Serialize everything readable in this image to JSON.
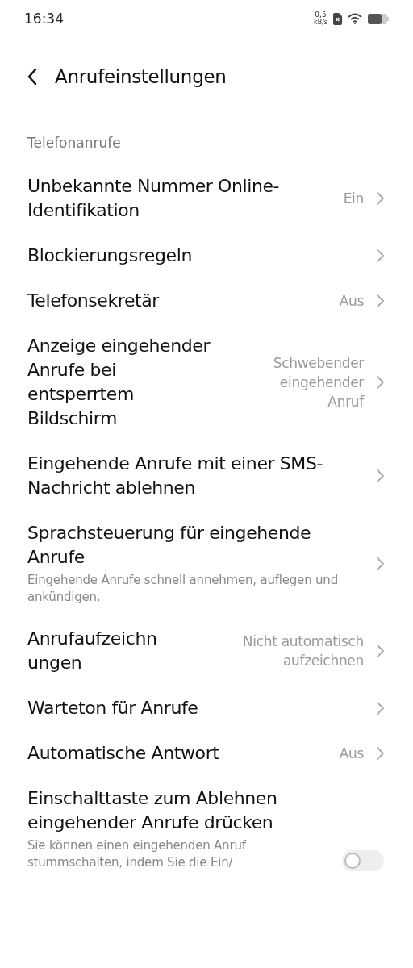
{
  "status_bar": {
    "time": "16:34",
    "net_speed": "0,5",
    "net_unit": "kB/s"
  },
  "header": {
    "title": "Anrufeinstellungen"
  },
  "section": {
    "title": "Telefonanrufe"
  },
  "items": [
    {
      "kind": "nav",
      "title": "Unbekannte Nummer Online-Identifikation",
      "value": "Ein"
    },
    {
      "kind": "nav",
      "title": "Blockierungsregeln"
    },
    {
      "kind": "nav",
      "title": "Telefonsekretär",
      "value": "Aus"
    },
    {
      "kind": "nav",
      "title": "Anzeige eingehender Anrufe bei entsperrtem Bildschirm",
      "value": "Schwebender eingehender Anruf"
    },
    {
      "kind": "nav",
      "title": "Eingehende Anrufe mit einer SMS-Nachricht ablehnen"
    },
    {
      "kind": "nav",
      "title": "Sprachsteuerung für eingehende Anrufe",
      "subtitle": "Eingehende Anrufe schnell annehmen, auflegen und ankündigen."
    },
    {
      "kind": "nav",
      "title": "Anrufaufzeichn ungen",
      "value": "Nicht automatisch aufzeichnen"
    },
    {
      "kind": "nav",
      "title": "Warteton für Anrufe"
    },
    {
      "kind": "nav",
      "title": "Automatische Antwort",
      "value": "Aus"
    },
    {
      "kind": "toggle",
      "title": "Einschalttaste zum Ablehnen eingehender Anrufe drücken",
      "subtitle": "Sie können einen eingehenden Anruf stummschalten, indem Sie die Ein/",
      "on": false
    }
  ]
}
